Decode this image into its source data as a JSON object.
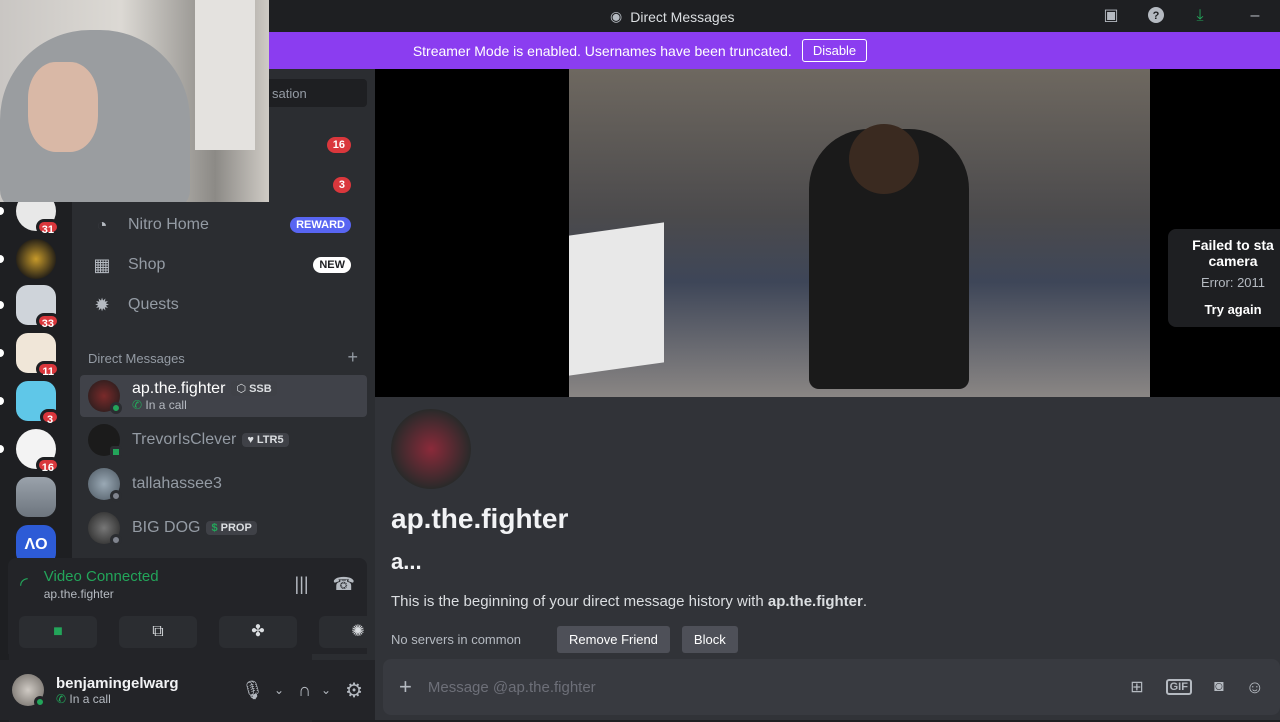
{
  "titlebar": {
    "title": "Direct Messages"
  },
  "banner": {
    "text": "Streamer Mode is enabled. Usernames have been truncated.",
    "button": "Disable"
  },
  "guilds": [
    {
      "badge": "31",
      "color": "#e8e8e8"
    },
    {
      "badge": "",
      "color": "#2a2418"
    },
    {
      "badge": "33",
      "color": "#cfd4da"
    },
    {
      "badge": "11",
      "color": "#f0e6d8"
    },
    {
      "badge": "3",
      "color": "#5fc7e8"
    },
    {
      "badge": "16",
      "color": "#f3f3f3"
    },
    {
      "badge": "",
      "color": "#9aa2ab"
    },
    {
      "badge": "",
      "color": "#2d5bd6"
    }
  ],
  "sidebar": {
    "search_text": "sation",
    "top_badges": [
      "16",
      "3"
    ],
    "nav": [
      {
        "label": "Nitro Home",
        "badge": "REWARD",
        "icon": "nitro-icon"
      },
      {
        "label": "Shop",
        "badge": "NEW",
        "icon": "shop-icon"
      },
      {
        "label": "Quests",
        "badge": "",
        "icon": "quests-icon"
      }
    ],
    "dm_header": "Direct Messages",
    "dms": [
      {
        "name": "ap.the.fighter",
        "tag": "SSB",
        "sub": "In a call",
        "active": true
      },
      {
        "name": "TrevorIsClever",
        "tag": "LTR5",
        "sub": ""
      },
      {
        "name": "tallahassee3",
        "tag": "",
        "sub": ""
      },
      {
        "name": "BIG DOG",
        "tag": "PROP",
        "sub": ""
      }
    ]
  },
  "voice": {
    "status": "Video Connected",
    "channel": "ap.the.fighter"
  },
  "user": {
    "name": "benjamingelwarg",
    "status": "In a call"
  },
  "video": {
    "fail_title": "Failed to sta",
    "fail_title2": "camera",
    "fail_error": "Error: 2011",
    "fail_button": "Try again"
  },
  "intro": {
    "title": "ap.the.fighter",
    "subtitle": "a...",
    "begin_prefix": "This is the beginning of your direct message history with ",
    "begin_name": "ap.the.fighter",
    "begin_suffix": ".",
    "no_servers": "No servers in common",
    "remove_friend": "Remove Friend",
    "block": "Block"
  },
  "composer": {
    "placeholder": "Message @ap.the.fighter"
  },
  "colors": {
    "banner": "#8b3df0",
    "online": "#23a55a",
    "badge": "#da373c",
    "reward": "#5865f2"
  }
}
